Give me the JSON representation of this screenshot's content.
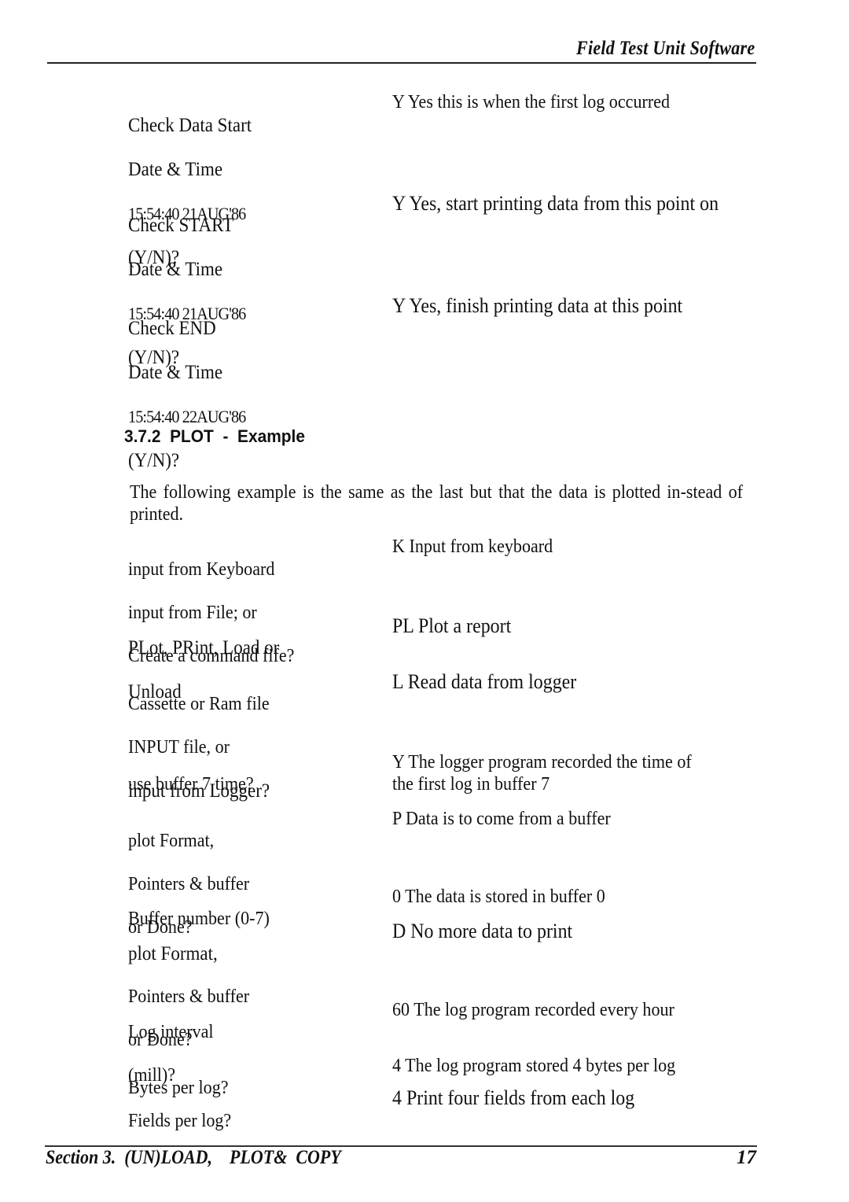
{
  "header": {
    "title": "Field Test Unit Software"
  },
  "first_block": [
    {
      "prompt_lines": [
        "Check Data Start",
        "Date & Time",
        "15:54:40    21AUG'86",
        "(Y/N)?"
      ],
      "response": "Y Yes  this  is  when  the  first  log  occurred"
    },
    {
      "prompt_lines": [
        "Check START",
        "Date & Time",
        "15:54:40    21AUG'86",
        "(Y/N)?"
      ],
      "response": "Y Yes, start printing data from this point on"
    },
    {
      "prompt_lines": [
        "Check END",
        "Date & Time",
        "15:54:40    22AUG'86",
        "(Y/N)?"
      ],
      "response": "Y Yes, finish printing data at this point"
    }
  ],
  "section": {
    "heading": "3.7.2  PLOT  -  Example",
    "intro": "The following example is the same as the last but that the data is plotted in-stead of printed."
  },
  "second_block": [
    {
      "prompt_lines": [
        "input  from  Keyboard",
        "input  from  File;  or",
        "Create  a  command  fife?"
      ],
      "response": "K  Input  from  keyboard"
    },
    {
      "prompt_lines": [
        "PLot, PRint, Load or",
        "Unload"
      ],
      "response": "PL Plot a report"
    },
    {
      "prompt_lines": [
        "Cassette  or  Ram  file",
        "INPUT  file,  or",
        "input from Logger?"
      ],
      "response": "L Read data from logger"
    },
    {
      "prompt_lines": [
        "use buffer  7  time?"
      ],
      "response": "Y  The  logger  program  recorded  the  time  of\nthe  first  log  in  buffer  7"
    },
    {
      "prompt_lines": [
        "plot   Format,",
        "Pointers  &  buffer",
        "or  Done?"
      ],
      "response": "P  Data  is  to  come  from  a  buffer"
    },
    {
      "prompt_lines": [
        "Buffer  number  (0-7)"
      ],
      "response": "0  The  data  is  stored  in  buffer  0"
    },
    {
      "prompt_lines": [
        "plot Format,",
        "Pointers  &  buffer",
        "or  Done?"
      ],
      "response": "D No more data to print"
    },
    {
      "prompt_lines": [
        "Log   interval",
        "(mill)?"
      ],
      "response": "60   The  log  program  recorded  every  hour"
    },
    {
      "prompt_lines": [
        "Bytes  per  log?"
      ],
      "response": "4  The  log  program  stored  4  bytes  per  log"
    },
    {
      "prompt_lines": [
        "Fields  per  log?"
      ],
      "response": "4 Print four fields from each log"
    }
  ],
  "footer": {
    "section_label": "Section 3.  (UN)LOAD,    PLOT&  COPY",
    "page_number": "17"
  }
}
